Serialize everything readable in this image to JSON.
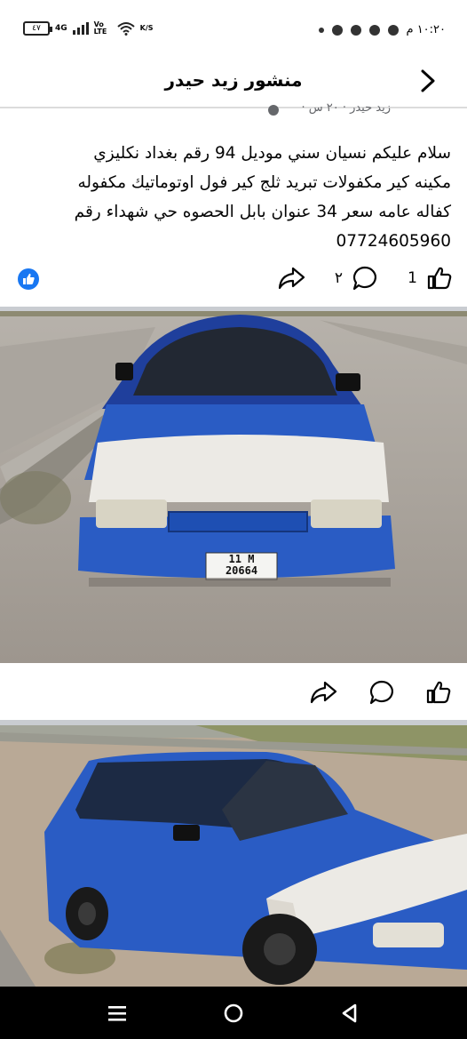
{
  "status_bar": {
    "time": "١٠:٢٠ م",
    "battery": "٤٧",
    "network": "4G",
    "volte": "Vo LTE",
    "speed": "K/S"
  },
  "header": {
    "title": "منشور زيد حيدر"
  },
  "post": {
    "author_meta": "زيد حيدر · ٢٠ س ·",
    "text_lines": [
      "سلام عليكم نسيان سني موديل 94 رقم بغداد نكليزي",
      "مكينه كير مكفولات تبريد ثلج كير  فول  اوتوماتيك مكفوله",
      "كفاله عامه سعر 34 عنوان بابل الحصوه حي شهداء  رقم",
      "07724605960"
    ],
    "reactions": {
      "likes_count": "1",
      "comments_count": "٢"
    }
  },
  "photo_one": {
    "plate_line1": "11 M",
    "plate_line2": "20664"
  },
  "colors": {
    "accent": "#1877f2",
    "car_blue": "#2a5cc4",
    "separator": "#c9ccd1"
  },
  "icons": [
    "back-arrow-icon",
    "like-icon",
    "comment-icon",
    "share-icon",
    "menu-icon",
    "home-icon",
    "back-triangle-icon"
  ]
}
